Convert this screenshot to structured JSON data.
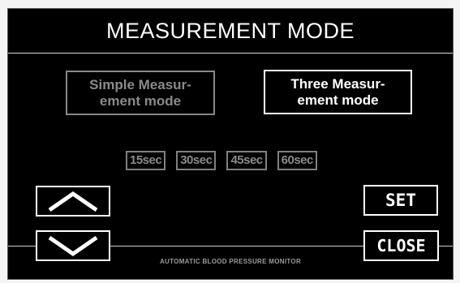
{
  "title": "MEASUREMENT MODE",
  "modes": [
    {
      "label": "Simple Measur-\nement mode",
      "selected": false
    },
    {
      "label": "Three Measur-\nement mode",
      "selected": true
    }
  ],
  "intervals": [
    "15sec",
    "30sec",
    "45sec",
    "60sec"
  ],
  "buttons": {
    "up_icon": "arrow-up-icon",
    "down_icon": "arrow-down-icon",
    "set_label": "SET",
    "close_label": "CLOSE"
  },
  "footer": "AUTOMATIC BLOOD PRESSURE MONITOR",
  "colors": {
    "background": "#000000",
    "active": "#ffffff",
    "inactive": "#888888"
  }
}
